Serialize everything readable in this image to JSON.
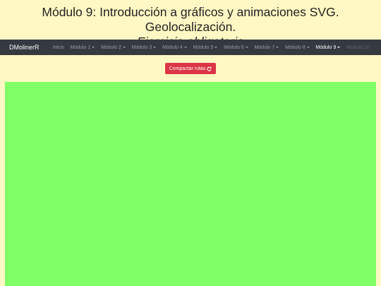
{
  "header": {
    "title": "Módulo 9: Introducción a gráficos y animaciones SVG. Geolocalización.",
    "subtitle": "Ejercicio obligatorio"
  },
  "navbar": {
    "brand": "DMolinerR",
    "items": [
      {
        "label": "Inicio"
      },
      {
        "label": "Módulo 1"
      },
      {
        "label": "Módulo 2"
      },
      {
        "label": "Módulo 3"
      },
      {
        "label": "Módulo 4"
      },
      {
        "label": "Módulo 5"
      },
      {
        "label": "Módulo 6"
      },
      {
        "label": "Módulo 7"
      },
      {
        "label": "Módulo 8"
      },
      {
        "label": "Módulo 9"
      },
      {
        "label": "Módulo 10"
      }
    ]
  },
  "actions": {
    "compact_label": "Compactar rutas",
    "compact_icon": "refresh-icon"
  },
  "colors": {
    "background": "#fff8c4",
    "navbar": "#343a40",
    "button": "#dc3545",
    "canvas": "#80ff66"
  }
}
